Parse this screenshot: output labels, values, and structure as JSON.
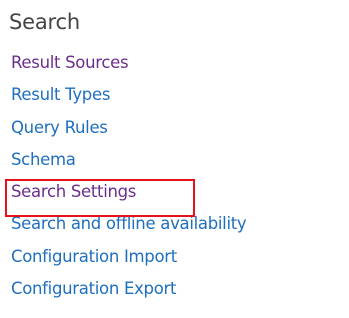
{
  "section": {
    "title": "Search",
    "links": [
      {
        "label": "Result Sources",
        "color": "#6b2d8c"
      },
      {
        "label": "Result Types",
        "color": "#1e6fbf"
      },
      {
        "label": "Query Rules",
        "color": "#1e6fbf"
      },
      {
        "label": "Schema",
        "color": "#1e6fbf"
      },
      {
        "label": "Search Settings",
        "color": "#6b2d8c",
        "highlighted": true
      },
      {
        "label": "Search and offline availability",
        "color": "#1e6fbf"
      },
      {
        "label": "Configuration Import",
        "color": "#1e6fbf"
      },
      {
        "label": "Configuration Export",
        "color": "#1e6fbf"
      }
    ]
  },
  "colors": {
    "heading": "#444444",
    "link": "#1e6fbf",
    "visited_link": "#6b2d8c",
    "highlight_border": "#e8101c"
  }
}
